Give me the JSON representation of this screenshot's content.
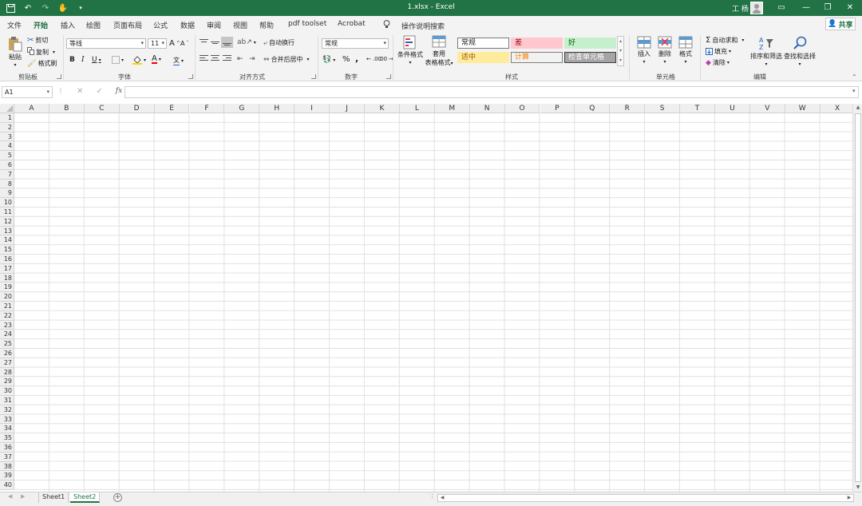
{
  "window": {
    "title": "1.xlsx - Excel",
    "user": "工 杨",
    "accent": "#217346"
  },
  "tabs": [
    "文件",
    "开始",
    "插入",
    "绘图",
    "页面布局",
    "公式",
    "数据",
    "审阅",
    "视图",
    "帮助",
    "pdf toolset",
    "Acrobat"
  ],
  "active_tab": "开始",
  "tell_me": "操作说明搜索",
  "share_label": "共享",
  "ribbon": {
    "clipboard": {
      "paste": "粘贴",
      "cut": "剪切",
      "copy": "复制",
      "format_painter": "格式刷",
      "label": "剪贴板"
    },
    "font": {
      "name": "等线",
      "size": "11",
      "bold": "B",
      "italic": "I",
      "underline": "U",
      "grow": "A",
      "shrink": "A",
      "font_color": "A",
      "wen": "文",
      "label": "字体"
    },
    "alignment": {
      "wrap_text": "自动换行",
      "merge_center": "合并后居中",
      "label": "对齐方式"
    },
    "number": {
      "format": "常规",
      "percent": "%",
      "comma": ",",
      "inc_decimal": ".00",
      "dec_decimal": ".00",
      "label": "数字"
    },
    "styles": {
      "conditional_formatting": "条件格式",
      "format_as_table_line1": "套用",
      "format_as_table_line2": "表格格式",
      "cells": [
        {
          "label": "常规",
          "bg": "#ffffff",
          "color": "#222222",
          "border": "#7a7a7a"
        },
        {
          "label": "差",
          "bg": "#ffc7ce",
          "color": "#9c0006",
          "border": "transparent"
        },
        {
          "label": "好",
          "bg": "#c6efce",
          "color": "#006100",
          "border": "transparent"
        },
        {
          "label": "适中",
          "bg": "#ffeb9c",
          "color": "#9c5700",
          "border": "transparent"
        },
        {
          "label": "计算",
          "bg": "#f2f2f2",
          "color": "#fa7d00",
          "border": "#7f7f7f"
        },
        {
          "label": "检查单元格",
          "bg": "#a5a5a5",
          "color": "#ffffff",
          "border": "#3f3f3f"
        }
      ],
      "label": "样式"
    },
    "cells_group": {
      "insert": "插入",
      "delete": "删除",
      "format": "格式",
      "label": "单元格"
    },
    "editing": {
      "autosum": "自动求和",
      "fill": "填充",
      "clear": "清除",
      "sort_filter": "排序和筛选",
      "find_select": "查找和选择",
      "label": "编辑"
    }
  },
  "formula_bar": {
    "name_box": "A1",
    "fx": "fx",
    "value": ""
  },
  "grid": {
    "columns": [
      "A",
      "B",
      "C",
      "D",
      "E",
      "F",
      "G",
      "H",
      "I",
      "J",
      "K",
      "L",
      "M",
      "N",
      "O",
      "P",
      "Q",
      "R",
      "S",
      "T",
      "U",
      "V",
      "W",
      "X"
    ],
    "rows": [
      "1",
      "2",
      "3",
      "4",
      "5",
      "6",
      "7",
      "8",
      "9",
      "10",
      "11",
      "12",
      "13",
      "14",
      "15",
      "16",
      "17",
      "18",
      "19",
      "20",
      "21",
      "22",
      "23",
      "24",
      "25",
      "26",
      "27",
      "28",
      "29",
      "30",
      "31",
      "32",
      "33",
      "34",
      "35",
      "36",
      "37",
      "38",
      "39",
      "40"
    ]
  },
  "sheets": [
    "Sheet1",
    "Sheet2"
  ],
  "active_sheet": "Sheet2"
}
